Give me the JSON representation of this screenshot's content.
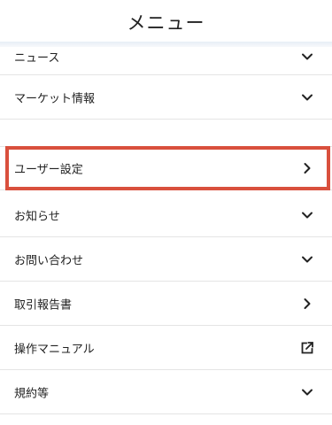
{
  "header": {
    "title": "メニュー"
  },
  "menu": {
    "items": [
      {
        "label": "ニュース",
        "icon": "chevron-down-icon"
      },
      {
        "label": "マーケット情報",
        "icon": "chevron-down-icon"
      },
      {
        "label": "ユーザー設定",
        "icon": "chevron-right-icon"
      },
      {
        "label": "お知らせ",
        "icon": "chevron-down-icon"
      },
      {
        "label": "お問い合わせ",
        "icon": "chevron-down-icon"
      },
      {
        "label": "取引報告書",
        "icon": "chevron-right-icon"
      },
      {
        "label": "操作マニュアル",
        "icon": "external-link-icon"
      },
      {
        "label": "規約等",
        "icon": "chevron-down-icon"
      }
    ]
  },
  "highlight": {
    "target": "ユーザー設定",
    "color": "#d9503d"
  }
}
